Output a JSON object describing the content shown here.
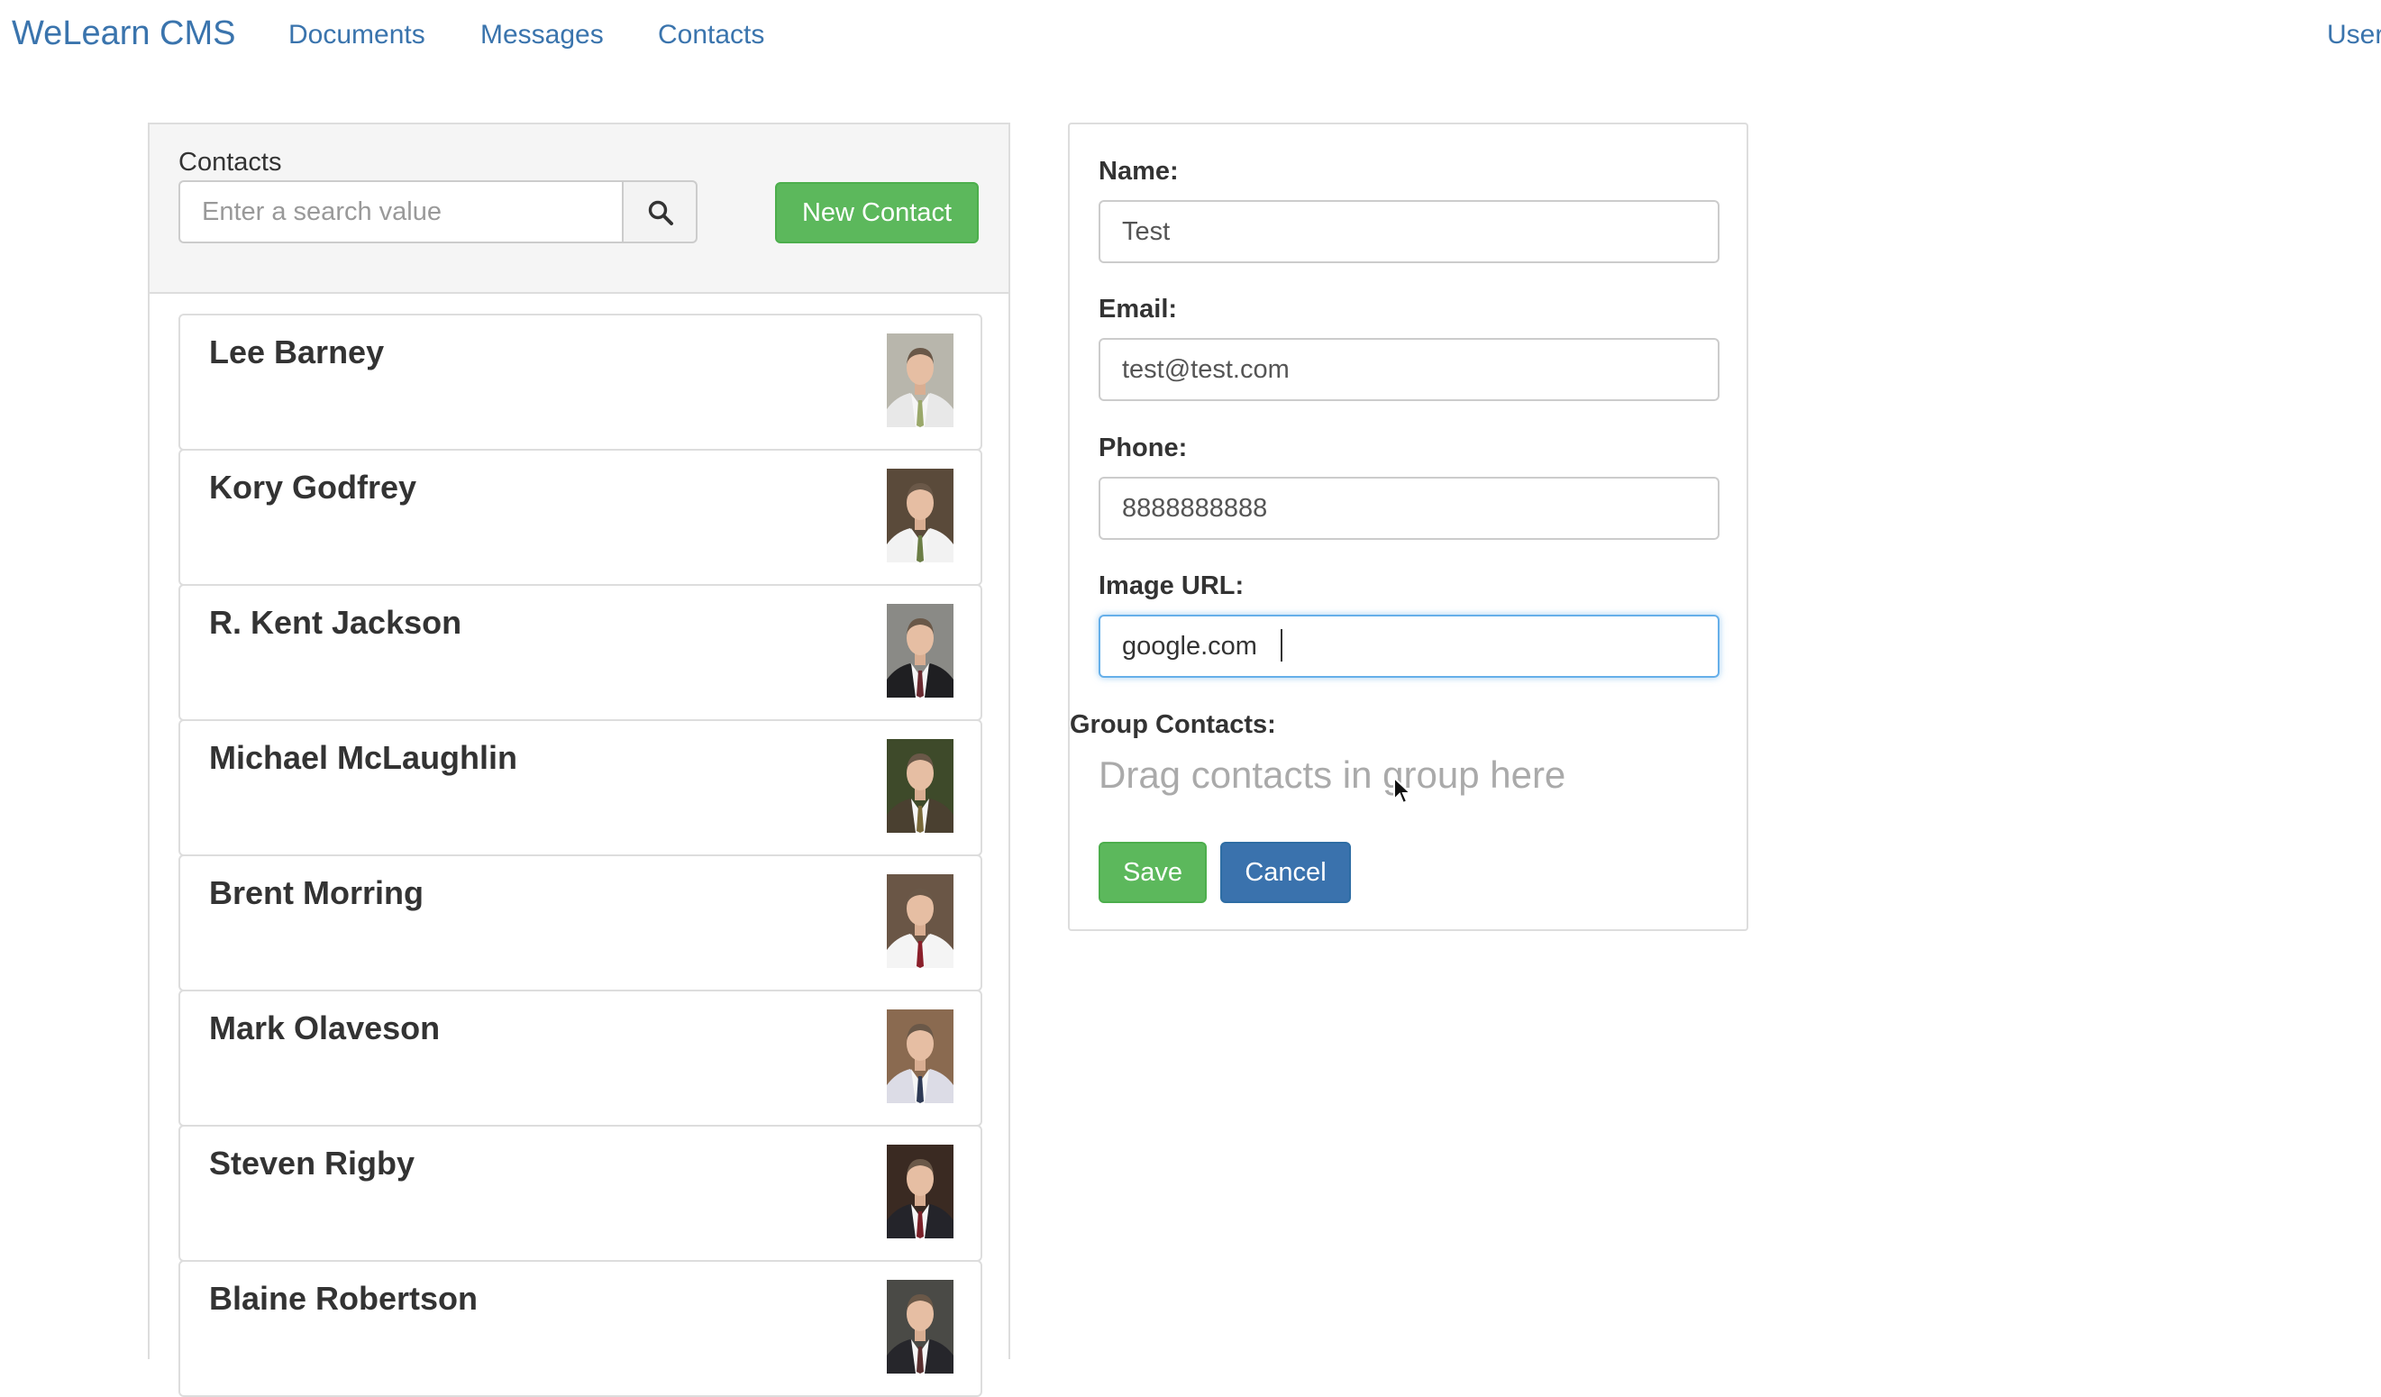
{
  "navbar": {
    "brand": "WeLearn CMS",
    "links": [
      "Documents",
      "Messages",
      "Contacts"
    ],
    "user_label": "User"
  },
  "contacts_panel": {
    "title": "Contacts",
    "search": {
      "placeholder": "Enter a search value",
      "value": "",
      "icon": "search-icon"
    },
    "new_contact_label": "New Contact",
    "contacts": [
      {
        "name": "Lee Barney",
        "photo": "portrait-photo",
        "tie": "#9aa86a",
        "suit": "#e8e8e8",
        "backdrop": "#b8b6ac"
      },
      {
        "name": "Kory Godfrey",
        "photo": "portrait-photo",
        "tie": "#6b7d45",
        "suit": "#f2f2f2",
        "backdrop": "#5a4a3a"
      },
      {
        "name": "R. Kent Jackson",
        "photo": "portrait-photo",
        "tie": "#6a2a30",
        "suit": "#1f1f22",
        "backdrop": "#8a8a86"
      },
      {
        "name": "Michael McLaughlin",
        "photo": "portrait-photo",
        "tie": "#7a6a3a",
        "suit": "#4a4030",
        "backdrop": "#3e4a2a"
      },
      {
        "name": "Brent Morring",
        "photo": "portrait-photo",
        "tie": "#8a1f2a",
        "suit": "#f4f4f4",
        "backdrop": "#6a5646"
      },
      {
        "name": "Mark Olaveson",
        "photo": "portrait-photo",
        "tie": "#2e3a55",
        "suit": "#dcdce6",
        "backdrop": "#8a6a50"
      },
      {
        "name": "Steven Rigby",
        "photo": "portrait-photo",
        "tie": "#7a2028",
        "suit": "#24242a",
        "backdrop": "#3a2a22"
      },
      {
        "name": "Blaine Robertson",
        "photo": "portrait-photo",
        "tie": "#5a3030",
        "suit": "#26262b",
        "backdrop": "#4a4a46"
      }
    ]
  },
  "form": {
    "name_label": "Name:",
    "name_value": "Test",
    "email_label": "Email:",
    "email_value": "test@test.com",
    "phone_label": "Phone:",
    "phone_value": "8888888888",
    "image_url_label": "Image URL:",
    "image_url_value": "google.com",
    "group_contacts_label": "Group Contacts:",
    "group_drop_hint": "Drag contacts in group here",
    "save_label": "Save",
    "cancel_label": "Cancel"
  },
  "colors": {
    "link": "#3a74ad",
    "success": "#5cb85c",
    "primary": "#3a72ad",
    "focus_border": "#66afe9"
  }
}
